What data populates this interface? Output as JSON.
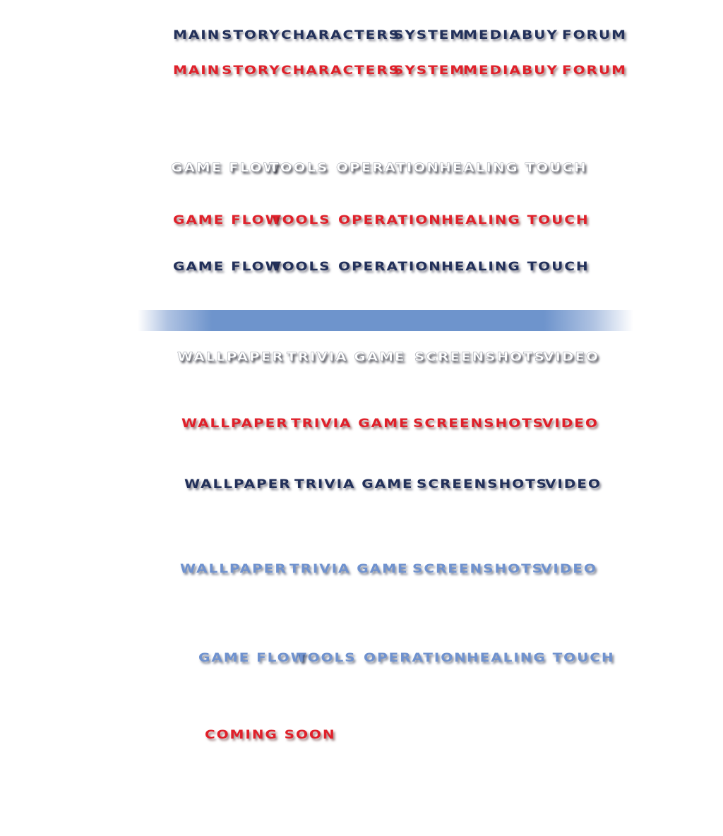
{
  "colors": {
    "navy": "#22305a",
    "red": "#e0202a",
    "white": "#ffffff",
    "blue": "#6f92cf",
    "bar": "#6e94cc"
  },
  "main_nav": {
    "normal": {
      "main": "MAIN",
      "story": "STORY",
      "characters": "CHARACTERS",
      "system": "SYSTEM",
      "media": "MEDIA",
      "buy": "BUY",
      "forum": "FORUM"
    },
    "hover": {
      "main": "MAIN",
      "story": "STORY",
      "characters": "CHARACTERS",
      "system": "SYSTEM",
      "media": "MEDIA",
      "buy": "BUY",
      "forum": "FORUM"
    }
  },
  "system_nav": {
    "white": {
      "game_flow": "GAME FLOW",
      "tools": "TOOLS",
      "operation": "OPERATION",
      "healing_touch": "HEALING TOUCH"
    },
    "red": {
      "game_flow": "GAME FLOW",
      "tools": "TOOLS",
      "operation": "OPERATION",
      "healing_touch": "HEALING TOUCH"
    },
    "navy": {
      "game_flow": "GAME FLOW",
      "tools": "TOOLS",
      "operation": "OPERATION",
      "healing_touch": "HEALING TOUCH"
    },
    "blue": {
      "game_flow": "GAME FLOW",
      "tools": "TOOLS",
      "operation": "OPERATION",
      "healing_touch": "HEALING TOUCH"
    }
  },
  "media_nav": {
    "white": {
      "wallpaper": "WALLPAPER",
      "trivia_game": "TRIVIA GAME",
      "screenshots": "SCREENSHOTS",
      "video": "VIDEO"
    },
    "red": {
      "wallpaper": "WALLPAPER",
      "trivia_game": "TRIVIA GAME",
      "screenshots": "SCREENSHOTS",
      "video": "VIDEO"
    },
    "navy": {
      "wallpaper": "WALLPAPER",
      "trivia_game": "TRIVIA GAME",
      "screenshots": "SCREENSHOTS",
      "video": "VIDEO"
    },
    "blue": {
      "wallpaper": "WALLPAPER",
      "trivia_game": "TRIVIA GAME",
      "screenshots": "SCREENSHOTS",
      "video": "VIDEO"
    }
  },
  "coming_soon": "COMING SOON"
}
